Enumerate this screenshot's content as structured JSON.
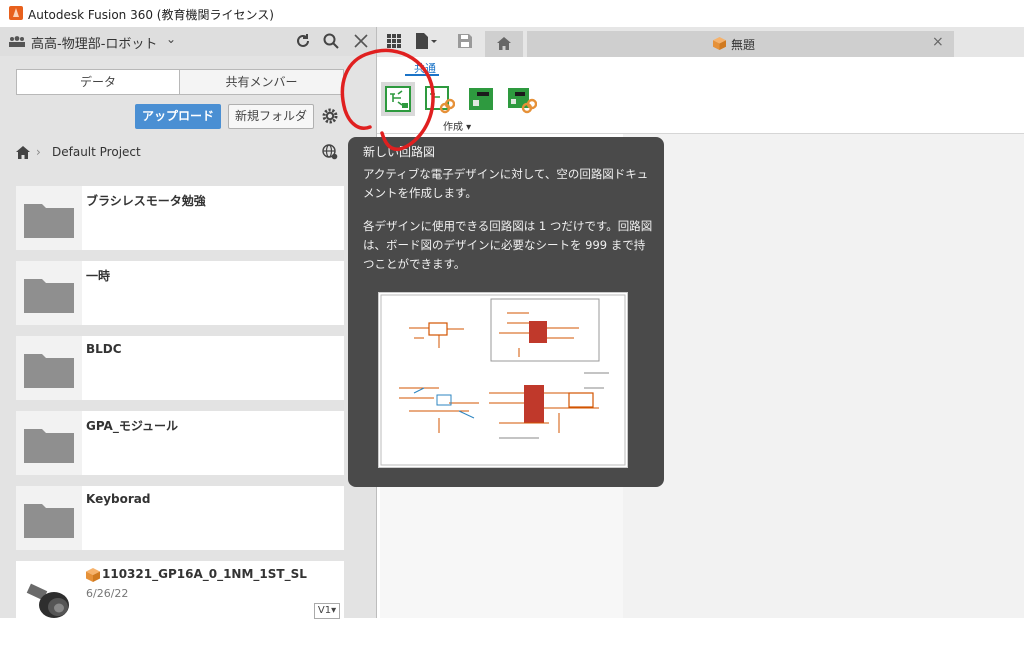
{
  "window": {
    "title": "Autodesk Fusion 360 (教育機関ライセンス)"
  },
  "data_panel": {
    "team_name": "高高-物理部-ロボット",
    "tabs": [
      {
        "label": "データ",
        "active": true
      },
      {
        "label": "共有メンバー",
        "active": false
      }
    ],
    "upload_label": "アップロード",
    "new_folder_label": "新規フォルダ",
    "breadcrumb": "Default Project",
    "folders": [
      {
        "name": "ブラシレスモータ勉強"
      },
      {
        "name": "一時"
      },
      {
        "name": "BLDC"
      },
      {
        "name": "GPA_モジュール"
      },
      {
        "name": "Keyborad"
      }
    ],
    "design": {
      "name": "110321_GP16A_0_1NM_1ST_SL",
      "date": "6/26/22",
      "version": "V1▾"
    }
  },
  "document_tab": {
    "label": "無題",
    "close": "×"
  },
  "toolbar": {
    "tab_label": "共通",
    "create_label": "作成 ▾"
  },
  "tooltip": {
    "title": "新しい回路図",
    "paragraph1": "アクティブな電子デザインに対して、空の回路図ドキュメントを作成します。",
    "paragraph2": "各デザインに使用できる回路図は 1 つだけです。回路図は、ボード図のデザインに必要なシートを 999 まで持つことができます。"
  },
  "colors": {
    "accent": "#4a8fd3",
    "annotation": "#e02020",
    "tooltip_bg": "#4a4a4a",
    "folder": "#8f8f8f"
  }
}
